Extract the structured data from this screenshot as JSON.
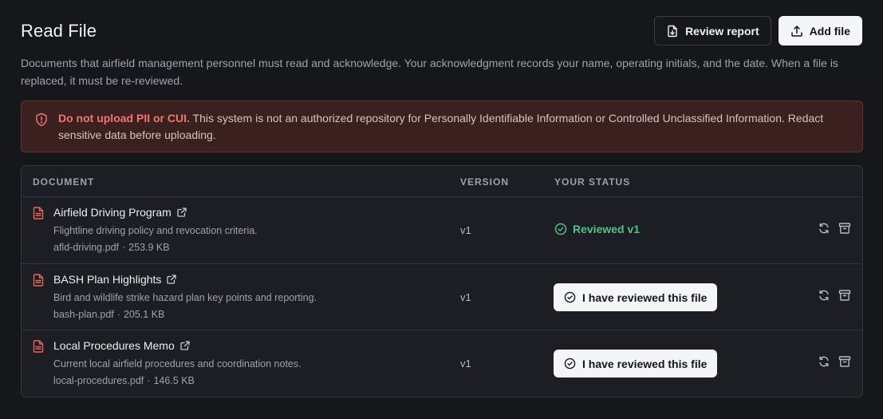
{
  "page": {
    "title": "Read File",
    "description": "Documents that airfield management personnel must read and acknowledge. Your acknowledgment records your name, operating initials, and the date. When a file is replaced, it must be re-reviewed."
  },
  "header_actions": {
    "review_report": "Review report",
    "add_file": "Add file"
  },
  "alert": {
    "strong": "Do not upload PII or CUI.",
    "text": " This system is not an authorized repository for Personally Identifiable Information or Controlled Unclassified Information. Redact sensitive data before uploading."
  },
  "table": {
    "columns": {
      "document": "DOCUMENT",
      "version": "VERSION",
      "status": "YOUR STATUS"
    },
    "rows": [
      {
        "name": "Airfield Driving Program",
        "description": "Flightline driving policy and revocation criteria.",
        "filename": "afld-driving.pdf",
        "size": "253.9 KB",
        "version": "v1",
        "status": "Reviewed v1"
      },
      {
        "name": "BASH Plan Highlights",
        "description": "Bird and wildlife strike hazard plan key points and reporting.",
        "filename": "bash-plan.pdf",
        "size": "205.1 KB",
        "version": "v1",
        "status": "I have reviewed this file"
      },
      {
        "name": "Local Procedures Memo",
        "description": "Current local airfield procedures and coordination notes.",
        "filename": "local-procedures.pdf",
        "size": "146.5 KB",
        "version": "v1",
        "status": "I have reviewed this file"
      }
    ],
    "meta_separator": "·"
  },
  "icons": {
    "review_report": "file-download-icon",
    "add_file": "upload-icon",
    "alert": "shield-alert-icon",
    "document": "file-text-icon",
    "external_link": "external-link-icon",
    "reviewed": "check-circle-icon",
    "replace": "refresh-icon",
    "archive": "archive-icon"
  },
  "colors": {
    "background": "#16171b",
    "alert_accent": "#f2776b",
    "reviewed_green": "#55c08a",
    "doc_icon_red": "#e5685d"
  }
}
